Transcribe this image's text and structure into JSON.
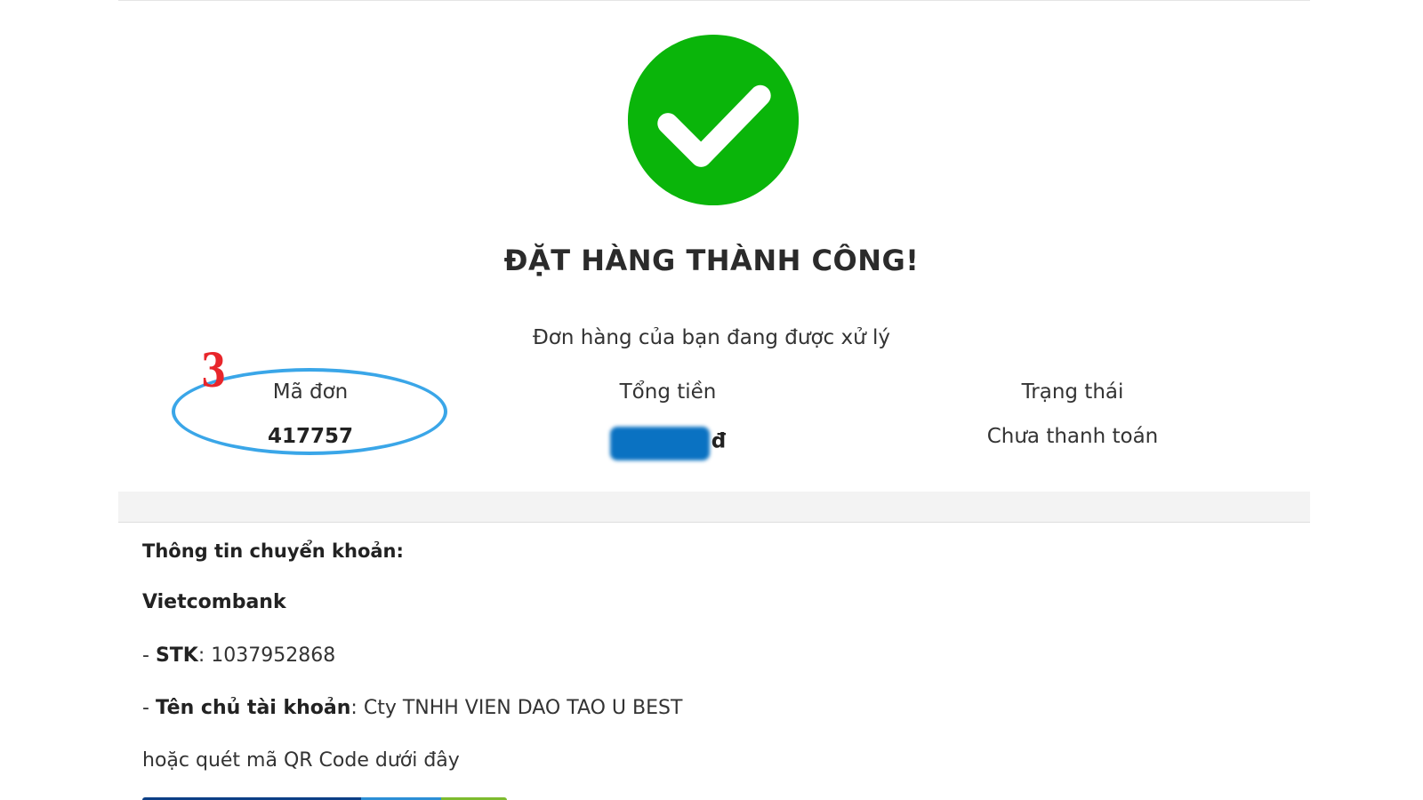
{
  "status": {
    "icon": "check-circle-icon",
    "icon_color": "#0ab50a",
    "title": "ĐẶT HÀNG THÀNH CÔNG!",
    "subtitle": "Đơn hàng của bạn đang được xử lý"
  },
  "summary": {
    "order_label": "Mã đơn",
    "order_value": "417757",
    "total_label": "Tổng tiền",
    "total_currency": "đ",
    "status_label": "Trạng thái",
    "status_value": "Chưa thanh toán"
  },
  "annotation": {
    "step_number": "3",
    "highlight_color": "#3aa6e8",
    "marker_color": "#e8262b"
  },
  "transfer": {
    "heading": "Thông tin chuyển khoản:",
    "bank": "Vietcombank",
    "stk_prefix": "- ",
    "stk_label": "STK",
    "stk_sep": ": ",
    "stk_value": "1037952868",
    "owner_prefix": "- ",
    "owner_label": "Tên chủ tài khoản",
    "owner_sep": ": ",
    "owner_value": "Cty TNHH VIEN DAO TAO U BEST",
    "qr_hint": "hoặc quét mã QR Code dưới đây"
  }
}
